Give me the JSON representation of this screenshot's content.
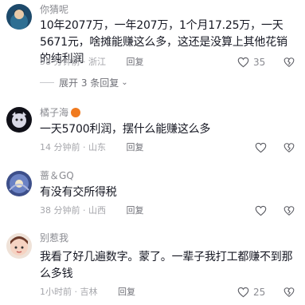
{
  "comments": [
    {
      "username": "你猜呢",
      "content": "10年2077万，一年207万，1个月17.25万，一天5671元，啥摊能赚这么多，这还是没算上其他花销的纯利润",
      "time": "58 分钟前",
      "location": "浙江",
      "reply_label": "回复",
      "likes": "35",
      "expand_label": "展开 3 条回复"
    },
    {
      "username": "橘子海",
      "content": "一天5700利润，摆什么能赚这么多",
      "time": "14 分钟前",
      "location": "山东",
      "reply_label": "回复",
      "likes": ""
    },
    {
      "username": "蔷＆GQ",
      "content": "有没有交所得税",
      "time": "38 分钟前",
      "location": "山西",
      "reply_label": "回复",
      "likes": ""
    },
    {
      "username": "别惹我",
      "content": "我看了好几遍数字。蒙了。一辈子我打工都赚不到那么多钱",
      "time": "1小时前",
      "location": "吉林",
      "reply_label": "回复",
      "likes": "25"
    }
  ],
  "meta_separator": "·",
  "colors": {
    "text": "#161823",
    "secondary": "#8a8b91",
    "badge": "#f07a1f"
  }
}
